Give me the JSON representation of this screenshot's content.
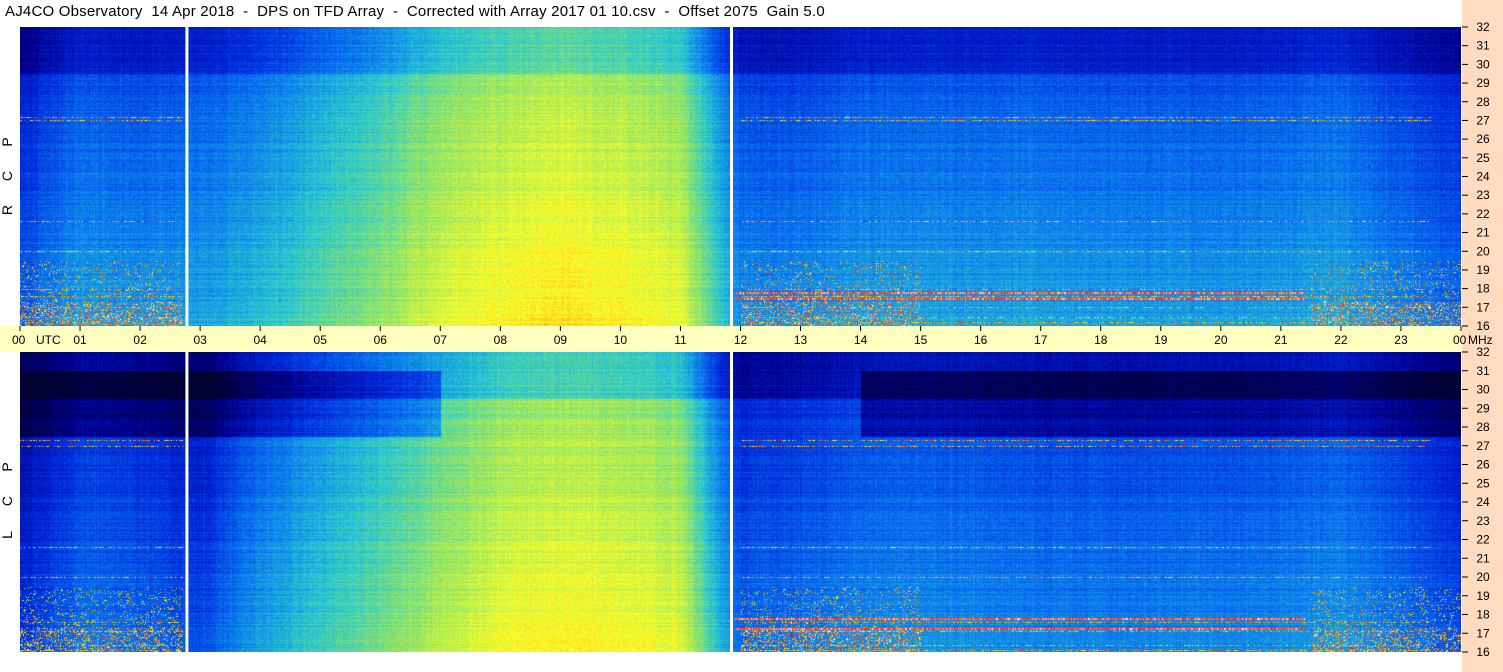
{
  "title": "AJ4CO Observatory  14 Apr 2018  -  DPS on TFD Array  -  Corrected with Array 2017 01 10.csv  -  Offset 2075  Gain 5.0",
  "colors": {
    "background": "#ffffff",
    "time_axis_band": "#ffffc0",
    "freq_axis_band": "#ffdcc0",
    "gap_line": "#ffffff"
  },
  "chart_data": {
    "type": "heatmap",
    "time_axis": {
      "unit_label": "UTC",
      "range_hours": [
        0,
        24
      ],
      "tick_labels": [
        "00",
        "01",
        "02",
        "03",
        "04",
        "05",
        "06",
        "07",
        "08",
        "09",
        "10",
        "11",
        "12",
        "13",
        "14",
        "15",
        "16",
        "17",
        "18",
        "19",
        "20",
        "21",
        "22",
        "23",
        "00"
      ]
    },
    "freq_axis": {
      "unit_label": "MHz",
      "range_mhz": [
        16,
        32
      ],
      "tick_labels": [
        "16",
        "17",
        "18",
        "19",
        "20",
        "21",
        "22",
        "23",
        "24",
        "25",
        "26",
        "27",
        "28",
        "29",
        "30",
        "31",
        "32"
      ]
    },
    "data_gaps_utc": [
      2.78,
      11.85
    ],
    "colormap": [
      "#000033",
      "#00008c",
      "#0028dc",
      "#0a78f0",
      "#28c8d2",
      "#96e664",
      "#ffff28",
      "#ff8c00",
      "#ff1e1e",
      "#ffffff"
    ],
    "panels": [
      {
        "name": "RCP",
        "side_label": [
          "P",
          "C",
          "R"
        ],
        "intensity_by_hour": [
          0.2,
          0.3,
          0.28,
          0.3,
          0.34,
          0.4,
          0.46,
          0.54,
          0.58,
          0.6,
          0.58,
          0.55,
          0.27,
          0.27,
          0.3,
          0.3,
          0.3,
          0.3,
          0.29,
          0.29,
          0.29,
          0.3,
          0.31,
          0.26,
          0.22
        ],
        "emission_lines_mhz": [
          16.2,
          16.5,
          17.0,
          17.6,
          18.0,
          20.0,
          21.6,
          27.0,
          27.2
        ],
        "bright_lines_mhz": [
          17.5,
          17.8
        ]
      },
      {
        "name": "LCP",
        "side_label": [
          "P",
          "C",
          "L"
        ],
        "intensity_by_hour": [
          0.14,
          0.24,
          0.22,
          0.18,
          0.3,
          0.37,
          0.43,
          0.5,
          0.56,
          0.58,
          0.57,
          0.54,
          0.22,
          0.24,
          0.27,
          0.28,
          0.27,
          0.26,
          0.26,
          0.26,
          0.26,
          0.27,
          0.29,
          0.24,
          0.18
        ],
        "emission_lines_mhz": [
          16.1,
          16.4,
          17.1,
          17.6,
          20.0,
          21.6,
          27.0,
          27.3
        ],
        "bright_lines_mhz": [
          17.3,
          17.8
        ]
      }
    ]
  }
}
